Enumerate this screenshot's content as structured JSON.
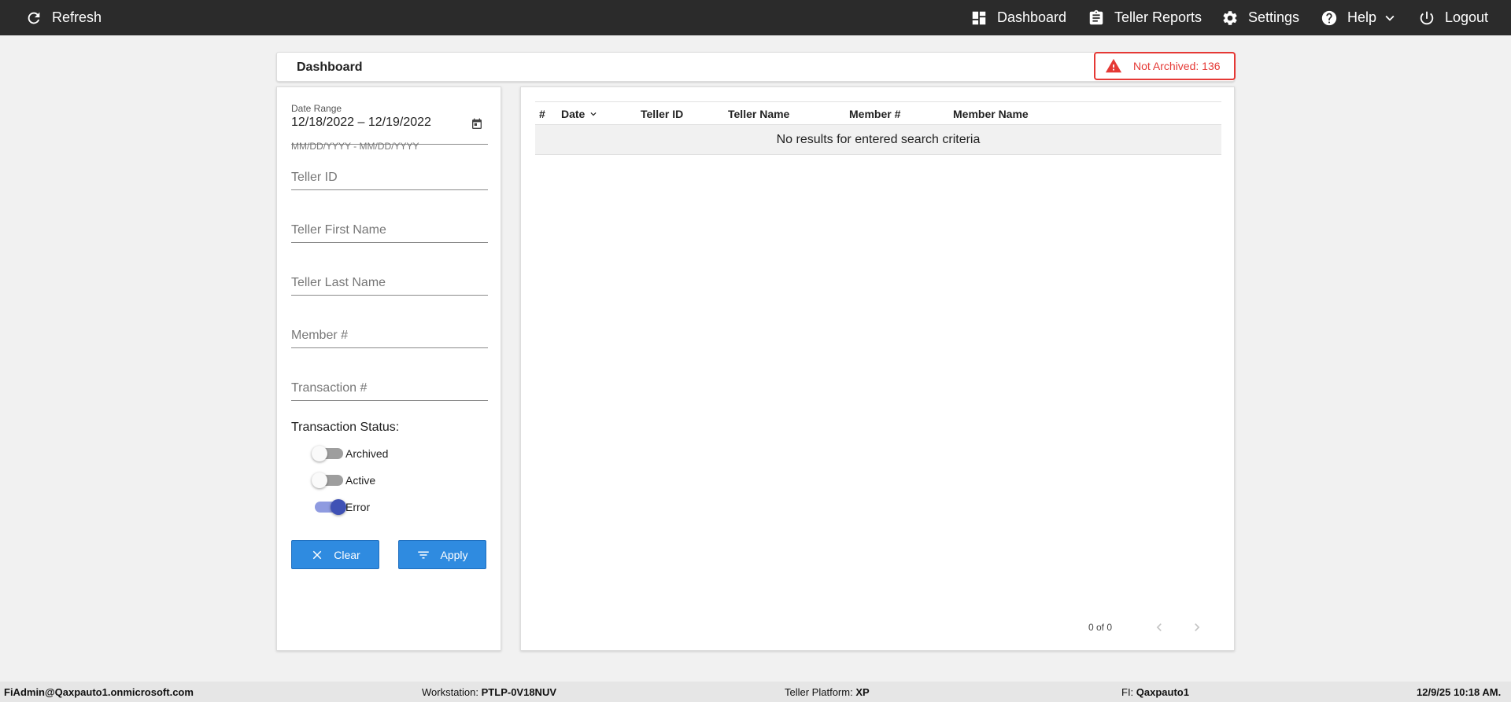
{
  "nav": {
    "refresh": "Refresh",
    "dashboard": "Dashboard",
    "teller_reports": "Teller Reports",
    "settings": "Settings",
    "help": "Help",
    "logout": "Logout"
  },
  "header": {
    "title": "Dashboard",
    "alert_text": "Not Archived: 136"
  },
  "filters": {
    "date_range_label": "Date Range",
    "date_range_value": "12/18/2022 – 12/19/2022",
    "date_hint": "MM/DD/YYYY - MM/DD/YYYY",
    "teller_id_placeholder": "Teller ID",
    "teller_first_name_placeholder": "Teller First Name",
    "teller_last_name_placeholder": "Teller Last Name",
    "member_placeholder": "Member #",
    "transaction_placeholder": "Transaction #",
    "status_title": "Transaction Status:",
    "statuses": [
      {
        "label": "Archived",
        "on": false
      },
      {
        "label": "Active",
        "on": false
      },
      {
        "label": "Error",
        "on": true
      }
    ],
    "clear_label": "Clear",
    "apply_label": "Apply"
  },
  "table": {
    "columns": [
      "#",
      "Date",
      "Teller ID",
      "Teller Name",
      "Member #",
      "Member Name"
    ],
    "empty_message": "No results for entered search criteria",
    "pager_text": "0 of 0"
  },
  "footer": {
    "user": "FiAdmin@Qaxpauto1.onmicrosoft.com",
    "workstation_label": "Workstation:",
    "workstation_value": "PTLP-0V18NUV",
    "platform_label": "Teller Platform:",
    "platform_value": "XP",
    "fi_label": "FI:",
    "fi_value": "Qaxpauto1",
    "datetime": "12/9/25 10:18 AM."
  },
  "colors": {
    "topbar": "#2b2b2b",
    "accent": "#2f8be0",
    "alert": "#e53935",
    "toggle_on": "#3f51b5"
  }
}
